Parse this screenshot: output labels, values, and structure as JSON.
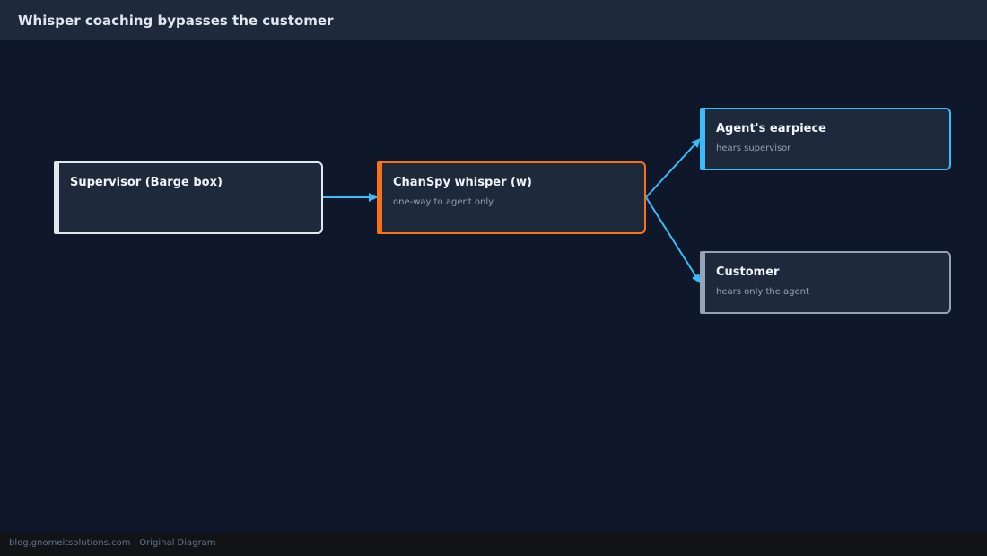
{
  "header": {
    "title": "Whisper coaching bypasses the customer"
  },
  "nodes": {
    "supervisor": {
      "title": "Supervisor (Barge box)",
      "subtitle": ""
    },
    "chanspy": {
      "title": "ChanSpy whisper (w)",
      "subtitle": "one-way to agent only"
    },
    "earpiece": {
      "title": "Agent's earpiece",
      "subtitle": "hears supervisor"
    },
    "customer": {
      "title": "Customer",
      "subtitle": "hears only the agent"
    }
  },
  "colors": {
    "background": "#0f172a",
    "header": "#1e293b",
    "node_fill": "#1e293b",
    "supervisor_border": "#e2e8f0",
    "chanspy_border": "#f97316",
    "earpiece_border": "#38bdf8",
    "customer_border": "#94a3b8",
    "connector": "#38bdf8"
  },
  "footer": {
    "text": "blog.gnomeitsolutions.com | Original Diagram"
  }
}
